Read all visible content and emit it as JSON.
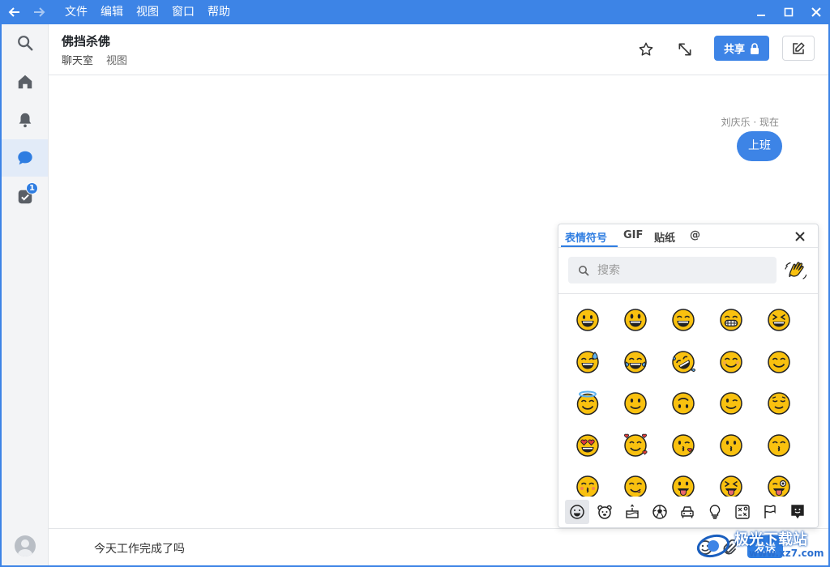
{
  "menu": [
    "文件",
    "编辑",
    "视图",
    "窗口",
    "帮助"
  ],
  "sidebar": {
    "items": [
      {
        "name": "search",
        "icon": "search-icon"
      },
      {
        "name": "home",
        "icon": "home-icon"
      },
      {
        "name": "notifications",
        "icon": "bell-icon"
      },
      {
        "name": "chat",
        "icon": "chat-bubble-icon",
        "active": true
      },
      {
        "name": "tasks",
        "icon": "task-check-icon",
        "badge": "1"
      }
    ]
  },
  "header": {
    "title": "佛挡杀佛",
    "tabs": [
      "聊天室",
      "视图"
    ],
    "share_label": "共享"
  },
  "message": {
    "meta": "刘庆乐 · 现在",
    "text": "上班"
  },
  "composer": {
    "text": "今天工作完成了吗",
    "send_label": "发送"
  },
  "picker": {
    "tabs": [
      "表情符号",
      "GIF",
      "贴纸",
      "@"
    ],
    "active_tab": "表情符号",
    "search_placeholder": "搜索",
    "categories": [
      "smileys",
      "animals",
      "food",
      "activity",
      "travel",
      "objects",
      "symbols",
      "flags",
      "custom"
    ]
  },
  "watermark": {
    "text": "极光下载站",
    "url": "www.xz7.com"
  },
  "colors": {
    "accent": "#3d84e6",
    "emoji_face": "#f9c10f"
  }
}
